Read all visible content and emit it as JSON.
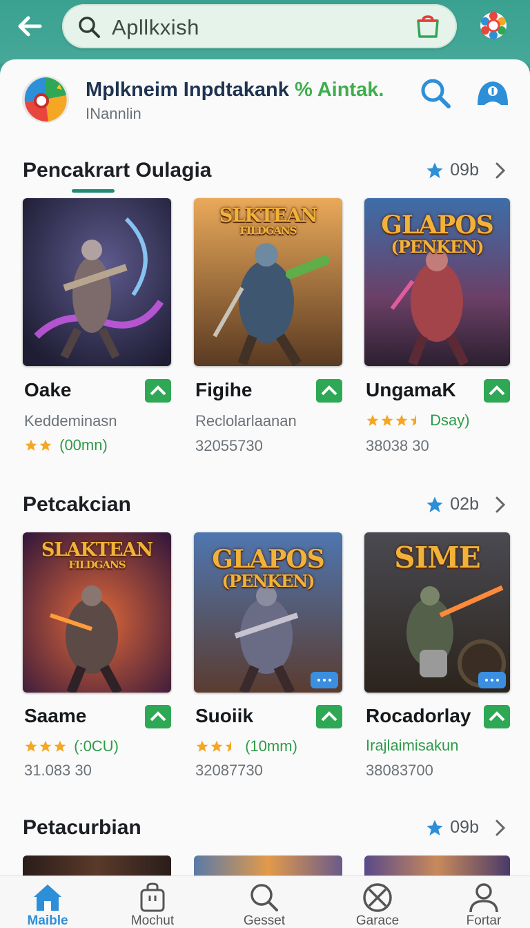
{
  "search": {
    "value": "Apllkxish"
  },
  "app": {
    "title": "Mplkneim Inpdtakank",
    "title_accent": "% Aintak.",
    "subtitle": "INannlin"
  },
  "colors": {
    "brand": "#3aa191",
    "accent_green": "#2fa856",
    "nav_active": "#2d8fd8",
    "star": "#f5a623",
    "meta_star": "#2d8fd8"
  },
  "sections": [
    {
      "title": "Pencakrart Oulagia",
      "count": "09b",
      "tiles": [
        {
          "name": "Oake",
          "line1": "Keddeminasn",
          "stars": 2,
          "rating_text": "(00mn)",
          "art_title": ""
        },
        {
          "name": "Figihe",
          "line1": "Reclolarlaanan",
          "line2": "32055730",
          "art_title": "SLKTEAN",
          "art_sub": "FILDGANS"
        },
        {
          "name": "UngamaK",
          "stars": 3.5,
          "rating_text": "Dsay)",
          "line2": "38038 30",
          "art_title": "GLAPOS",
          "art_sub": "(PENKEN)"
        }
      ]
    },
    {
      "title": "Petcakcian",
      "count": "02b",
      "tiles": [
        {
          "name": "Saame",
          "stars": 3,
          "rating_text": "(:0CU)",
          "line2": "31.083 30",
          "art_title": "SLAKTEAN",
          "art_sub": "FILDGANS"
        },
        {
          "name": "Suoiik",
          "stars": 2.5,
          "rating_text": "(10mm)",
          "line2": "32087730",
          "art_title": "GLAPOS",
          "art_sub": "(PENKEN)"
        },
        {
          "name": "Rocadorlay",
          "line1": "Irajlaimisakun",
          "line2": "38083700",
          "art_title": "SIME"
        }
      ]
    },
    {
      "title": "Petacurbian",
      "count": "09b"
    }
  ],
  "nav": [
    {
      "label": "Maible",
      "icon": "home-icon",
      "active": true
    },
    {
      "label": "Mochut",
      "icon": "bag-icon",
      "active": false
    },
    {
      "label": "Gesset",
      "icon": "search-icon",
      "active": false
    },
    {
      "label": "Garace",
      "icon": "blocked-icon",
      "active": false
    },
    {
      "label": "Fortar",
      "icon": "person-icon",
      "active": false
    }
  ]
}
